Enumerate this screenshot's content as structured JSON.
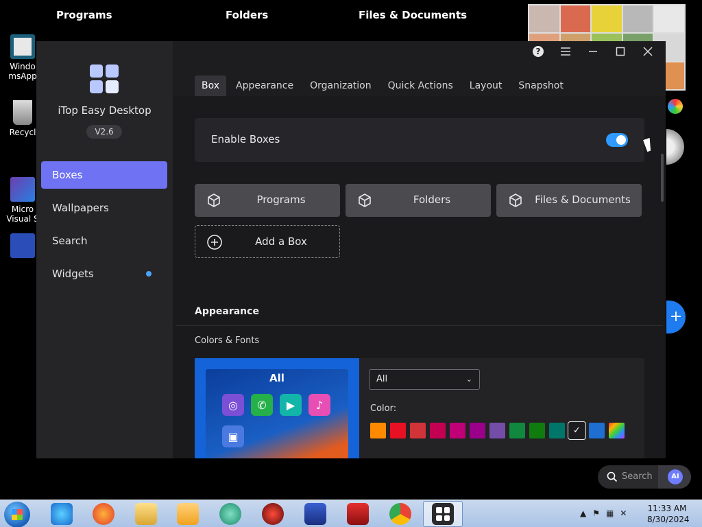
{
  "desktop": {
    "labels": [
      "Programs",
      "Folders",
      "Files & Documents"
    ],
    "icons": [
      "Windo msApp",
      "Recycl",
      "Micro Visual S",
      ""
    ]
  },
  "app": {
    "name": "iTop Easy Desktop",
    "version": "V2.6",
    "nav": [
      {
        "label": "Boxes",
        "active": true
      },
      {
        "label": "Wallpapers",
        "active": false
      },
      {
        "label": "Search",
        "active": false
      },
      {
        "label": "Widgets",
        "active": false,
        "dot": true
      }
    ],
    "tabs": [
      "Box",
      "Appearance",
      "Organization",
      "Quick Actions",
      "Layout",
      "Snapshot"
    ],
    "active_tab": "Box",
    "enable_boxes": {
      "label": "Enable Boxes",
      "enabled": true
    },
    "boxes": [
      "Programs",
      "Folders",
      "Files & Documents"
    ],
    "add_box_label": "Add a Box",
    "appearance": {
      "title": "Appearance",
      "subtitle": "Colors & Fonts",
      "preview_title": "All",
      "box_select": "All",
      "color_label": "Color:",
      "colors": [
        "#ff8a00",
        "#e81123",
        "#d13438",
        "#c30052",
        "#bf0077",
        "#9a0089",
        "#744da9",
        "#10893e",
        "#107c10",
        "#00766a",
        "#1d1d20",
        "#1e6fd1",
        "rainbow"
      ],
      "selected_color_index": 10
    }
  },
  "search_pill": {
    "placeholder": "Search",
    "ai_label": "AI"
  },
  "taskbar": {
    "time": "11:33 AM",
    "date": "8/30/2024"
  }
}
